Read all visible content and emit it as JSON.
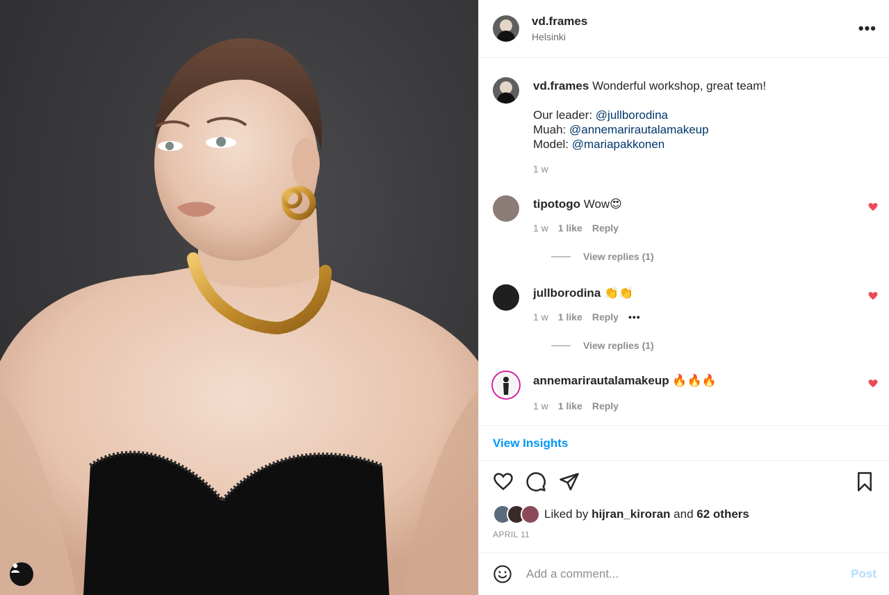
{
  "post": {
    "username": "vd.frames",
    "location": "Helsinki",
    "more": "•••",
    "caption": {
      "username": "vd.frames",
      "text": "Wonderful workshop, great team!",
      "lines": [
        {
          "label": "Our leader:",
          "mention": "@jullborodina"
        },
        {
          "label": "Muah:",
          "mention": "@annemarirautalamakeup"
        },
        {
          "label": "Model:",
          "mention": "@mariapakkonen"
        }
      ],
      "time": "1 w"
    }
  },
  "comments": [
    {
      "username": "tipotogo",
      "text": "Wow😍",
      "time": "1 w",
      "likes": "1 like",
      "reply": "Reply",
      "view_replies": "View replies (1)"
    },
    {
      "username": "jullborodina",
      "text": "👏👏",
      "time": "1 w",
      "likes": "1 like",
      "reply": "Reply",
      "more": "•••",
      "view_replies": "View replies (1)"
    },
    {
      "username": "annemarirautalamakeup",
      "text": "🔥🔥🔥",
      "time": "1 w",
      "likes": "1 like",
      "reply": "Reply"
    }
  ],
  "insights": "View Insights",
  "likes": {
    "prefix": "Liked by",
    "user": "hijran_kiroran",
    "middle": "and",
    "others": "62 others"
  },
  "date": "APRIL 11",
  "add_comment": {
    "placeholder": "Add a comment...",
    "post": "Post"
  },
  "colors": {
    "heart": "#ed4956",
    "link": "#0095f6",
    "mention": "#00376b"
  }
}
